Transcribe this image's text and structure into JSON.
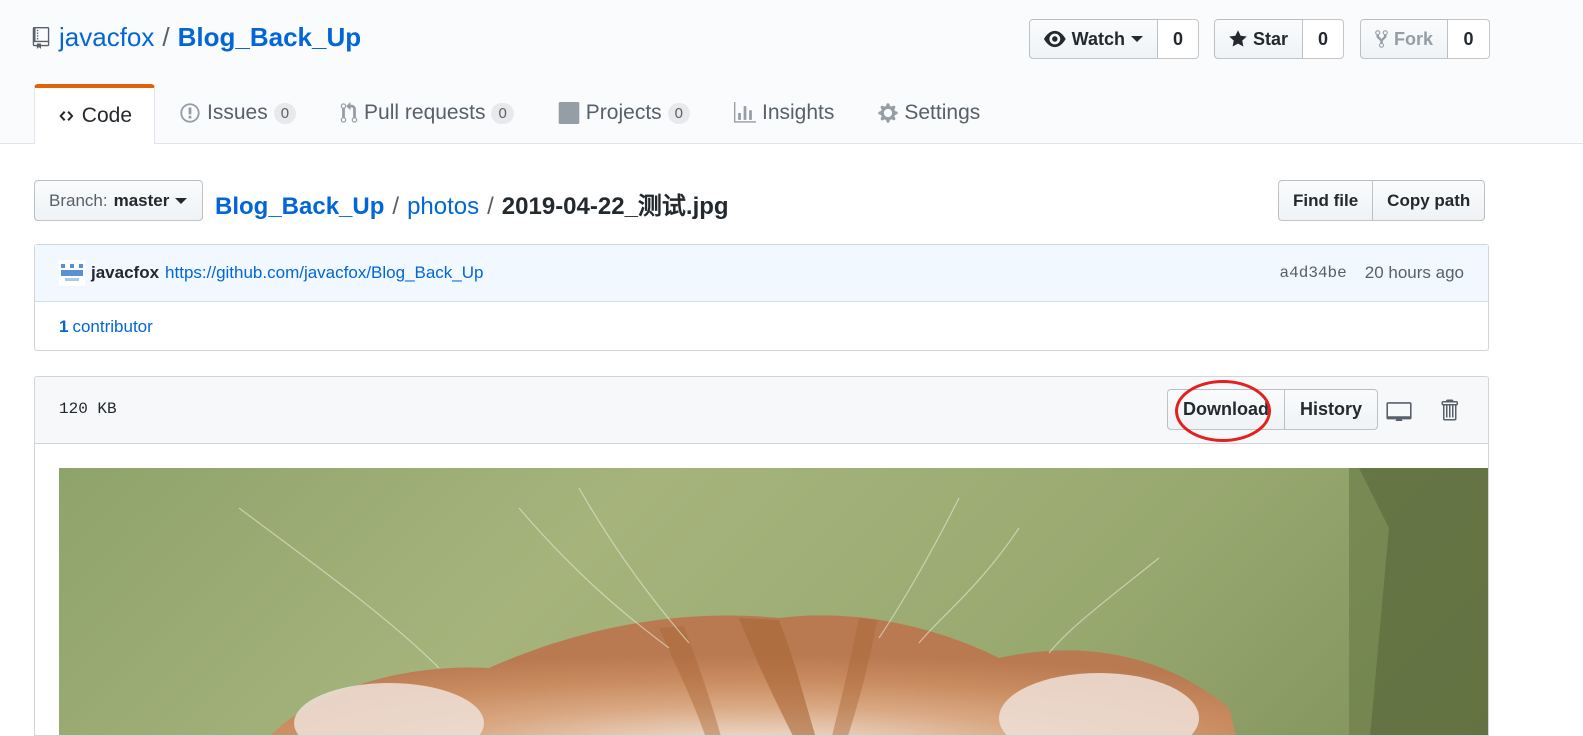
{
  "repo": {
    "owner": "javacfox",
    "separator": "/",
    "name": "Blog_Back_Up"
  },
  "actions": {
    "watch": {
      "label": "Watch",
      "count": "0"
    },
    "star": {
      "label": "Star",
      "count": "0"
    },
    "fork": {
      "label": "Fork",
      "count": "0"
    }
  },
  "tabs": [
    {
      "label": "Code",
      "icon": "code-icon"
    },
    {
      "label": "Issues",
      "count": "0",
      "icon": "issue-icon"
    },
    {
      "label": "Pull requests",
      "count": "0",
      "icon": "pull-request-icon"
    },
    {
      "label": "Projects",
      "count": "0",
      "icon": "project-icon"
    },
    {
      "label": "Insights",
      "icon": "graph-icon"
    },
    {
      "label": "Settings",
      "icon": "gear-icon"
    }
  ],
  "branch": {
    "prefix": "Branch:",
    "name": "master"
  },
  "breadcrumb": {
    "repo": "Blog_Back_Up",
    "folder": "photos",
    "file": "2019-04-22_测试.jpg",
    "sep": "/"
  },
  "file_nav": {
    "find_file": "Find file",
    "copy_path": "Copy path"
  },
  "commit": {
    "author": "javacfox",
    "message": "https://github.com/javacfox/Blog_Back_Up",
    "sha": "a4d34be",
    "time": "20 hours ago"
  },
  "contributors": {
    "count": "1",
    "label": "contributor"
  },
  "file": {
    "size": "120 KB",
    "download": "Download",
    "history": "History"
  },
  "colors": {
    "accent": "#0366d6",
    "tab_active": "#e36209",
    "highlight": "#e32020"
  }
}
